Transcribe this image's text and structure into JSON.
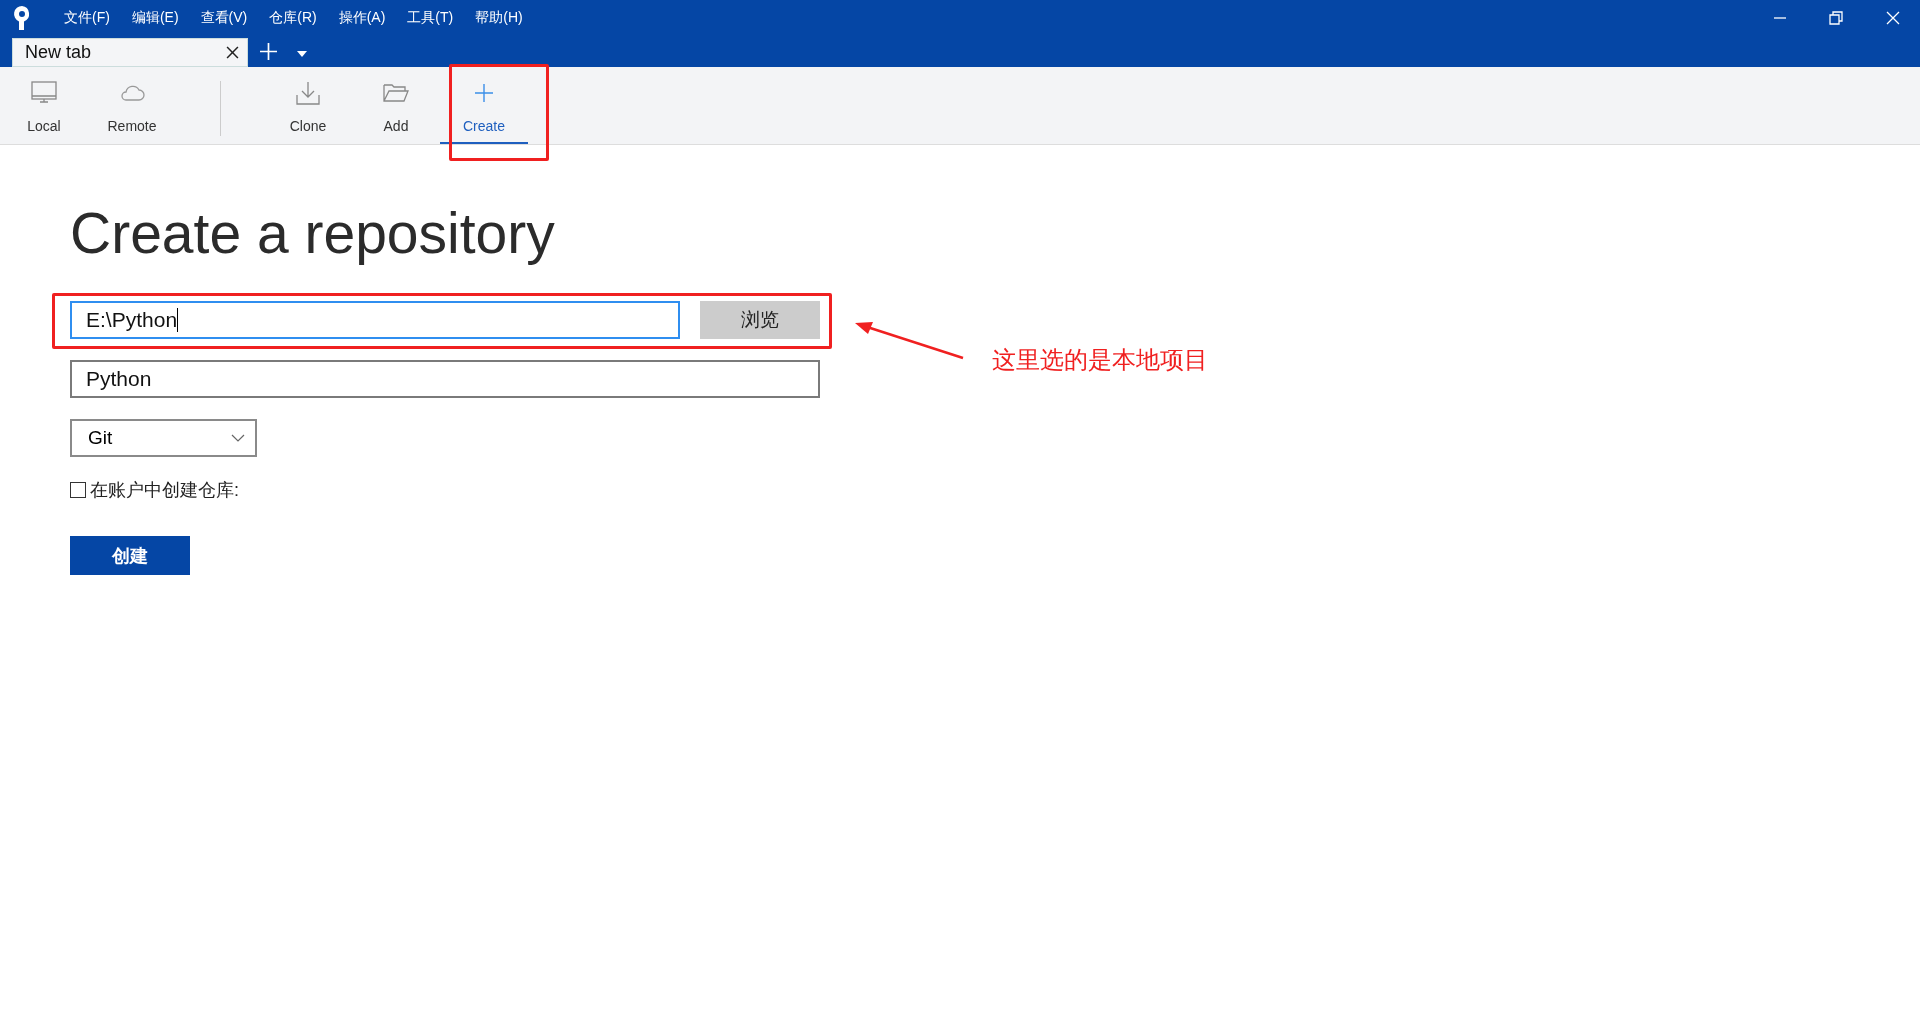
{
  "menu": [
    "文件(F)",
    "编辑(E)",
    "查看(V)",
    "仓库(R)",
    "操作(A)",
    "工具(T)",
    "帮助(H)"
  ],
  "tabs": [
    {
      "label": "New tab",
      "selected": true
    }
  ],
  "toolbar": [
    {
      "label": "Local",
      "kind": "local",
      "selected": false
    },
    {
      "label": "Remote",
      "kind": "remote",
      "selected": false
    },
    {
      "label": "Clone",
      "kind": "clone",
      "selected": false
    },
    {
      "label": "Add",
      "kind": "add",
      "selected": false
    },
    {
      "label": "Create",
      "kind": "create",
      "selected": true
    }
  ],
  "heading": "Create a repository",
  "path_field": {
    "value": "E:\\Python"
  },
  "browse_button": "浏览",
  "name_field": {
    "value": "Python"
  },
  "repo_type": {
    "value": "Git"
  },
  "account_checkbox": {
    "label": "在账户中创建仓库:",
    "checked": false
  },
  "create_button": "创建",
  "annotation": {
    "text": "这里选的是本地项目"
  }
}
